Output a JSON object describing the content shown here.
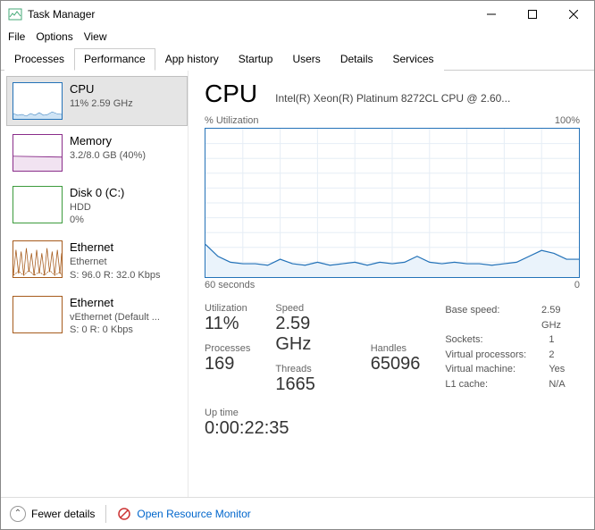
{
  "window": {
    "title": "Task Manager"
  },
  "menu": {
    "file": "File",
    "options": "Options",
    "view": "View"
  },
  "tabs": {
    "processes": "Processes",
    "performance": "Performance",
    "app_history": "App history",
    "startup": "Startup",
    "users": "Users",
    "details": "Details",
    "services": "Services"
  },
  "sidebar": {
    "cpu": {
      "title": "CPU",
      "sub": "11%  2.59 GHz"
    },
    "memory": {
      "title": "Memory",
      "sub": "3.2/8.0 GB (40%)"
    },
    "disk": {
      "title": "Disk 0 (C:)",
      "sub1": "HDD",
      "sub2": "0%"
    },
    "eth1": {
      "title": "Ethernet",
      "sub1": "Ethernet",
      "sub2": "S: 96.0  R: 32.0 Kbps"
    },
    "eth2": {
      "title": "Ethernet",
      "sub1": "vEthernet (Default ...",
      "sub2": "S: 0  R: 0 Kbps"
    }
  },
  "main": {
    "title": "CPU",
    "subtitle": "Intel(R) Xeon(R) Platinum 8272CL CPU @ 2.60...",
    "chart_ylabel": "% Utilization",
    "chart_ymax": "100%",
    "chart_xleft": "60 seconds",
    "chart_xright": "0",
    "stats": {
      "utilization_label": "Utilization",
      "utilization": "11%",
      "speed_label": "Speed",
      "speed": "2.59 GHz",
      "processes_label": "Processes",
      "processes": "169",
      "threads_label": "Threads",
      "threads": "1665",
      "handles_label": "Handles",
      "handles": "65096",
      "uptime_label": "Up time",
      "uptime": "0:00:22:35"
    },
    "right": {
      "base_speed_k": "Base speed:",
      "base_speed_v": "2.59 GHz",
      "sockets_k": "Sockets:",
      "sockets_v": "1",
      "vproc_k": "Virtual processors:",
      "vproc_v": "2",
      "vm_k": "Virtual machine:",
      "vm_v": "Yes",
      "l1_k": "L1 cache:",
      "l1_v": "N/A"
    }
  },
  "footer": {
    "fewer": "Fewer details",
    "resmon": "Open Resource Monitor"
  },
  "chart_data": {
    "type": "line",
    "title": "% Utilization",
    "xlabel": "60 seconds → 0",
    "ylabel": "% Utilization",
    "ylim": [
      0,
      100
    ],
    "x_seconds_ago": [
      60,
      58,
      56,
      54,
      52,
      50,
      48,
      46,
      44,
      42,
      40,
      38,
      36,
      34,
      32,
      30,
      28,
      26,
      24,
      22,
      20,
      18,
      16,
      14,
      12,
      10,
      8,
      6,
      4,
      2,
      0
    ],
    "values": [
      22,
      14,
      10,
      9,
      9,
      8,
      12,
      9,
      8,
      10,
      8,
      9,
      10,
      8,
      10,
      9,
      10,
      14,
      10,
      9,
      10,
      9,
      9,
      8,
      9,
      10,
      14,
      18,
      16,
      12,
      12
    ]
  }
}
